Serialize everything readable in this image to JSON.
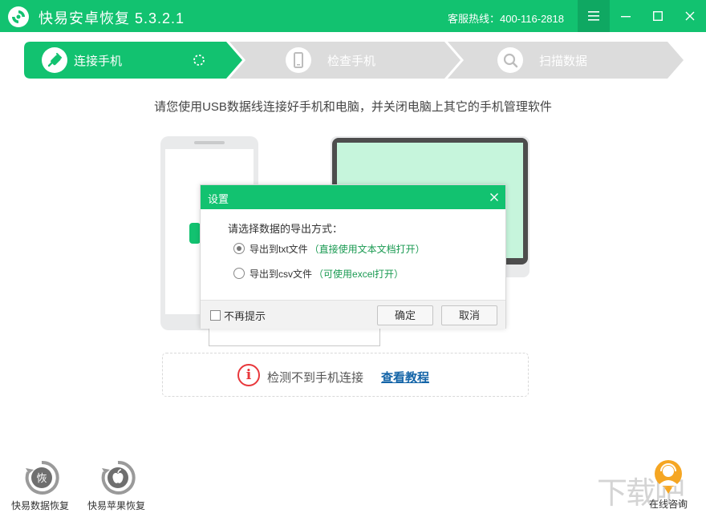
{
  "app": {
    "title": "快易安卓恢复  5.3.2.1",
    "hotline": "客服热线：400-116-2818"
  },
  "colors": {
    "brand": "#12c270",
    "inactive_step": "#dcdcdc",
    "warning": "#e8373b",
    "link": "#1565a8"
  },
  "steps": [
    {
      "label": "连接手机",
      "icon": "plug-icon",
      "active": true
    },
    {
      "label": "检查手机",
      "icon": "phone-icon",
      "active": false
    },
    {
      "label": "扫描数据",
      "icon": "magnifier-icon",
      "active": false
    }
  ],
  "instruction": "请您使用USB数据线连接好手机和电脑，并关闭电脑上其它的手机管理软件",
  "warning": {
    "text": "检测不到手机连接",
    "link": "查看教程"
  },
  "tools": [
    {
      "label": "快易数据恢复",
      "icon": "data-recovery-icon"
    },
    {
      "label": "快易苹果恢复",
      "icon": "apple-recovery-icon"
    }
  ],
  "chat": {
    "label": "在线咨询",
    "icon": "customer-service-icon"
  },
  "watermark": "下载吧",
  "dialog": {
    "title": "设置",
    "prompt": "请选择数据的导出方式：",
    "options": [
      {
        "label": "导出到txt文件",
        "hint": "（直接使用文本文档打开）",
        "selected": true
      },
      {
        "label": "导出到csv文件",
        "hint": "（可使用excel打开）",
        "selected": false
      }
    ],
    "no_prompt_label": "不再提示",
    "ok_label": "确定",
    "cancel_label": "取消"
  }
}
